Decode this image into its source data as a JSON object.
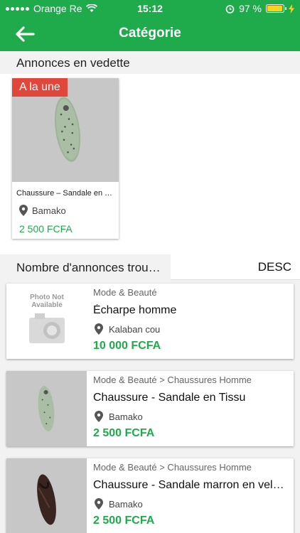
{
  "status_bar": {
    "carrier": "Orange Re",
    "time": "15:12",
    "battery": "97 %",
    "battery_level": 0.97
  },
  "header": {
    "title": "Catégorie"
  },
  "featured": {
    "section_title": "Annonces en vedette",
    "items": [
      {
        "badge": "A la une",
        "title": "Chaussure – Sandale en Tissu",
        "location": "Bamako",
        "price": "2 500 FCFA"
      }
    ]
  },
  "results": {
    "label": "Nombre d'annonces trouvées",
    "sort": "DESC"
  },
  "listings": [
    {
      "image_text": "Photo Not Available",
      "category": "Mode & Beauté",
      "title": "Écharpe homme",
      "location": "Kalaban cou",
      "price": "10 000 FCFA"
    },
    {
      "category": "Mode & Beauté > Chaussures Homme",
      "title": "Chaussure - Sandale en Tissu",
      "location": "Bamako",
      "price": "2 500 FCFA"
    },
    {
      "category": "Mode & Beauté > Chaussures Homme",
      "title": "Chaussure - Sandale marron en velours",
      "location": "Bamako",
      "price": "2 500 FCFA"
    }
  ],
  "colors": {
    "brand_green": "#1faa4b",
    "badge_red": "#e0463a"
  }
}
